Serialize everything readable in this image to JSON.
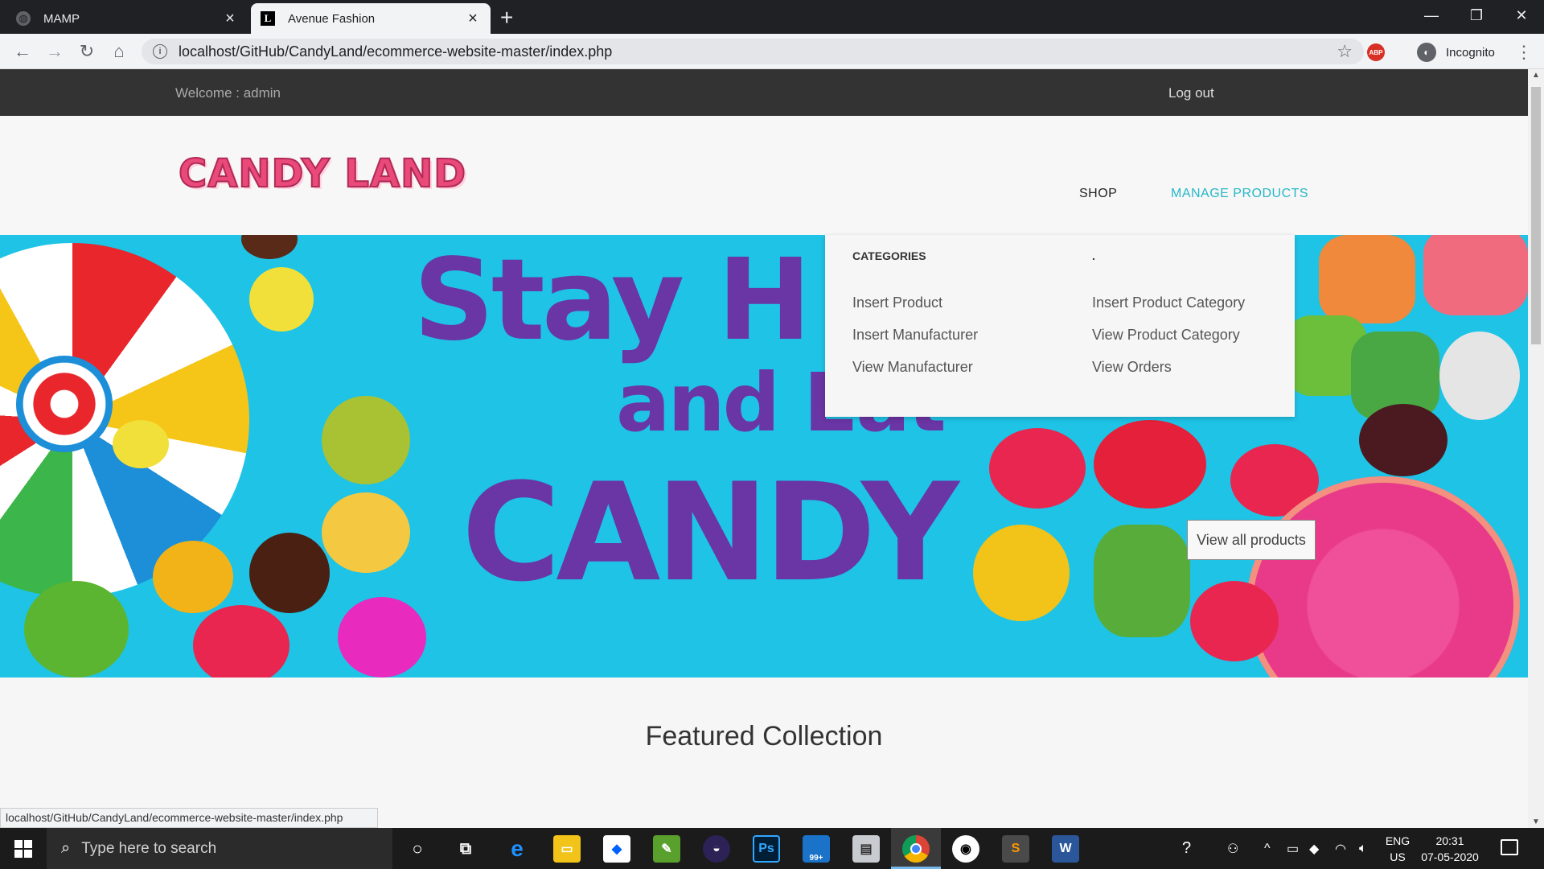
{
  "browser": {
    "tabs": [
      {
        "title": "MAMP",
        "active": false
      },
      {
        "title": "Avenue Fashion",
        "active": true
      }
    ],
    "new_tab_icon": "plus-icon",
    "url": "localhost/GitHub/CandyLand/ecommerce-website-master/index.php",
    "profile_label": "Incognito",
    "extension_badge": "ABP",
    "window_controls": [
      "minimize-icon",
      "restore-icon",
      "close-icon"
    ],
    "status_url": "localhost/GitHub/CandyLand/ecommerce-website-master/index.php"
  },
  "site": {
    "topbar": {
      "welcome": "Welcome : admin",
      "logout": "Log out"
    },
    "logo_text": "CANDY LAND",
    "nav": {
      "shop": "SHOP",
      "manage_products": "MANAGE PRODUCTS"
    },
    "dropdown": {
      "col1_heading": "CATEGORIES",
      "col2_heading": ".",
      "col1_items": [
        "Insert Product",
        "Insert Manufacturer",
        "View Manufacturer"
      ],
      "col2_items": [
        "Insert Product Category",
        "View Product Category",
        "View Orders"
      ]
    },
    "hero": {
      "line1": "Stay H",
      "line2": "and Eat",
      "line3": "CANDY",
      "button": "View all products"
    },
    "featured_title": "Featured Collection"
  },
  "taskbar": {
    "search_placeholder": "Type here to search",
    "mail_badge": "99+",
    "language": "ENG",
    "region": "US",
    "time": "20:31",
    "date": "07-05-2020"
  },
  "colors": {
    "accent": "#26b7c7",
    "topbar_bg": "#333333",
    "hero_bg": "#1ec3e6",
    "hero_text": "#6a35a4",
    "logo": "#e94a7a"
  }
}
